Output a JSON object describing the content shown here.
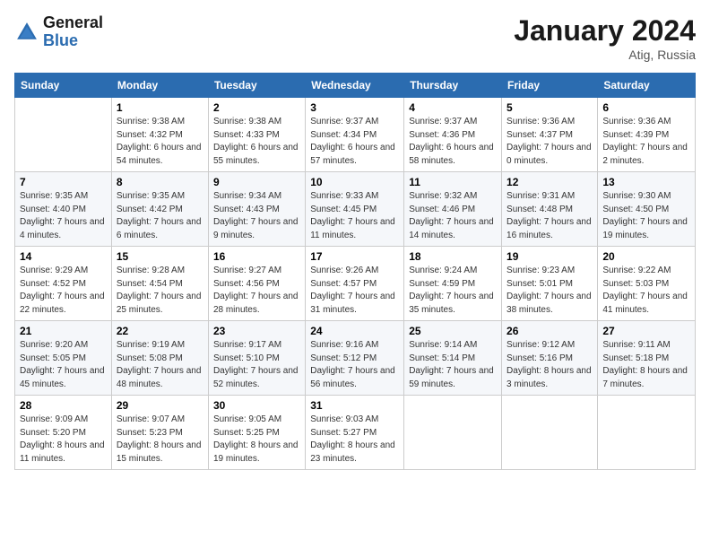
{
  "header": {
    "logo_line1": "General",
    "logo_line2": "Blue",
    "month_title": "January 2024",
    "subtitle": "Atig, Russia"
  },
  "weekdays": [
    "Sunday",
    "Monday",
    "Tuesday",
    "Wednesday",
    "Thursday",
    "Friday",
    "Saturday"
  ],
  "weeks": [
    [
      {
        "day": "",
        "sunrise": "",
        "sunset": "",
        "daylight": ""
      },
      {
        "day": "1",
        "sunrise": "Sunrise: 9:38 AM",
        "sunset": "Sunset: 4:32 PM",
        "daylight": "Daylight: 6 hours and 54 minutes."
      },
      {
        "day": "2",
        "sunrise": "Sunrise: 9:38 AM",
        "sunset": "Sunset: 4:33 PM",
        "daylight": "Daylight: 6 hours and 55 minutes."
      },
      {
        "day": "3",
        "sunrise": "Sunrise: 9:37 AM",
        "sunset": "Sunset: 4:34 PM",
        "daylight": "Daylight: 6 hours and 57 minutes."
      },
      {
        "day": "4",
        "sunrise": "Sunrise: 9:37 AM",
        "sunset": "Sunset: 4:36 PM",
        "daylight": "Daylight: 6 hours and 58 minutes."
      },
      {
        "day": "5",
        "sunrise": "Sunrise: 9:36 AM",
        "sunset": "Sunset: 4:37 PM",
        "daylight": "Daylight: 7 hours and 0 minutes."
      },
      {
        "day": "6",
        "sunrise": "Sunrise: 9:36 AM",
        "sunset": "Sunset: 4:39 PM",
        "daylight": "Daylight: 7 hours and 2 minutes."
      }
    ],
    [
      {
        "day": "7",
        "sunrise": "Sunrise: 9:35 AM",
        "sunset": "Sunset: 4:40 PM",
        "daylight": "Daylight: 7 hours and 4 minutes."
      },
      {
        "day": "8",
        "sunrise": "Sunrise: 9:35 AM",
        "sunset": "Sunset: 4:42 PM",
        "daylight": "Daylight: 7 hours and 6 minutes."
      },
      {
        "day": "9",
        "sunrise": "Sunrise: 9:34 AM",
        "sunset": "Sunset: 4:43 PM",
        "daylight": "Daylight: 7 hours and 9 minutes."
      },
      {
        "day": "10",
        "sunrise": "Sunrise: 9:33 AM",
        "sunset": "Sunset: 4:45 PM",
        "daylight": "Daylight: 7 hours and 11 minutes."
      },
      {
        "day": "11",
        "sunrise": "Sunrise: 9:32 AM",
        "sunset": "Sunset: 4:46 PM",
        "daylight": "Daylight: 7 hours and 14 minutes."
      },
      {
        "day": "12",
        "sunrise": "Sunrise: 9:31 AM",
        "sunset": "Sunset: 4:48 PM",
        "daylight": "Daylight: 7 hours and 16 minutes."
      },
      {
        "day": "13",
        "sunrise": "Sunrise: 9:30 AM",
        "sunset": "Sunset: 4:50 PM",
        "daylight": "Daylight: 7 hours and 19 minutes."
      }
    ],
    [
      {
        "day": "14",
        "sunrise": "Sunrise: 9:29 AM",
        "sunset": "Sunset: 4:52 PM",
        "daylight": "Daylight: 7 hours and 22 minutes."
      },
      {
        "day": "15",
        "sunrise": "Sunrise: 9:28 AM",
        "sunset": "Sunset: 4:54 PM",
        "daylight": "Daylight: 7 hours and 25 minutes."
      },
      {
        "day": "16",
        "sunrise": "Sunrise: 9:27 AM",
        "sunset": "Sunset: 4:56 PM",
        "daylight": "Daylight: 7 hours and 28 minutes."
      },
      {
        "day": "17",
        "sunrise": "Sunrise: 9:26 AM",
        "sunset": "Sunset: 4:57 PM",
        "daylight": "Daylight: 7 hours and 31 minutes."
      },
      {
        "day": "18",
        "sunrise": "Sunrise: 9:24 AM",
        "sunset": "Sunset: 4:59 PM",
        "daylight": "Daylight: 7 hours and 35 minutes."
      },
      {
        "day": "19",
        "sunrise": "Sunrise: 9:23 AM",
        "sunset": "Sunset: 5:01 PM",
        "daylight": "Daylight: 7 hours and 38 minutes."
      },
      {
        "day": "20",
        "sunrise": "Sunrise: 9:22 AM",
        "sunset": "Sunset: 5:03 PM",
        "daylight": "Daylight: 7 hours and 41 minutes."
      }
    ],
    [
      {
        "day": "21",
        "sunrise": "Sunrise: 9:20 AM",
        "sunset": "Sunset: 5:05 PM",
        "daylight": "Daylight: 7 hours and 45 minutes."
      },
      {
        "day": "22",
        "sunrise": "Sunrise: 9:19 AM",
        "sunset": "Sunset: 5:08 PM",
        "daylight": "Daylight: 7 hours and 48 minutes."
      },
      {
        "day": "23",
        "sunrise": "Sunrise: 9:17 AM",
        "sunset": "Sunset: 5:10 PM",
        "daylight": "Daylight: 7 hours and 52 minutes."
      },
      {
        "day": "24",
        "sunrise": "Sunrise: 9:16 AM",
        "sunset": "Sunset: 5:12 PM",
        "daylight": "Daylight: 7 hours and 56 minutes."
      },
      {
        "day": "25",
        "sunrise": "Sunrise: 9:14 AM",
        "sunset": "Sunset: 5:14 PM",
        "daylight": "Daylight: 7 hours and 59 minutes."
      },
      {
        "day": "26",
        "sunrise": "Sunrise: 9:12 AM",
        "sunset": "Sunset: 5:16 PM",
        "daylight": "Daylight: 8 hours and 3 minutes."
      },
      {
        "day": "27",
        "sunrise": "Sunrise: 9:11 AM",
        "sunset": "Sunset: 5:18 PM",
        "daylight": "Daylight: 8 hours and 7 minutes."
      }
    ],
    [
      {
        "day": "28",
        "sunrise": "Sunrise: 9:09 AM",
        "sunset": "Sunset: 5:20 PM",
        "daylight": "Daylight: 8 hours and 11 minutes."
      },
      {
        "day": "29",
        "sunrise": "Sunrise: 9:07 AM",
        "sunset": "Sunset: 5:23 PM",
        "daylight": "Daylight: 8 hours and 15 minutes."
      },
      {
        "day": "30",
        "sunrise": "Sunrise: 9:05 AM",
        "sunset": "Sunset: 5:25 PM",
        "daylight": "Daylight: 8 hours and 19 minutes."
      },
      {
        "day": "31",
        "sunrise": "Sunrise: 9:03 AM",
        "sunset": "Sunset: 5:27 PM",
        "daylight": "Daylight: 8 hours and 23 minutes."
      },
      {
        "day": "",
        "sunrise": "",
        "sunset": "",
        "daylight": ""
      },
      {
        "day": "",
        "sunrise": "",
        "sunset": "",
        "daylight": ""
      },
      {
        "day": "",
        "sunrise": "",
        "sunset": "",
        "daylight": ""
      }
    ]
  ]
}
